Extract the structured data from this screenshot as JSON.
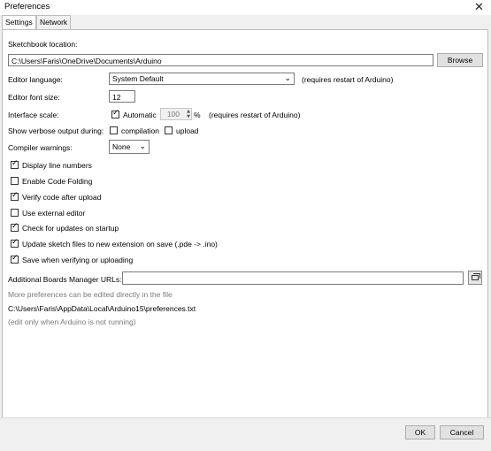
{
  "window": {
    "title": "Preferences",
    "close_glyph": "✕"
  },
  "tabs": [
    {
      "label": "Settings",
      "active": true
    },
    {
      "label": "Network",
      "active": false
    }
  ],
  "sketchbook": {
    "label": "Sketchbook location:",
    "value": "C:\\Users\\Faris\\OneDrive\\Documents\\Arduino",
    "browse_label": "Browse"
  },
  "editor_language": {
    "label": "Editor language:",
    "value": "System Default",
    "note": "(requires restart of Arduino)"
  },
  "editor_font_size": {
    "label": "Editor font size:",
    "value": "12"
  },
  "interface_scale": {
    "label": "Interface scale:",
    "automatic_label": "Automatic",
    "automatic_checked": true,
    "value": "100",
    "unit": "%",
    "note": "(requires restart of Arduino)"
  },
  "verbose": {
    "label": "Show verbose output during:",
    "compilation_label": "compilation",
    "compilation_checked": false,
    "upload_label": "upload",
    "upload_checked": false
  },
  "compiler_warnings": {
    "label": "Compiler warnings:",
    "value": "None"
  },
  "options": [
    {
      "label": "Display line numbers",
      "checked": true
    },
    {
      "label": "Enable Code Folding",
      "checked": false
    },
    {
      "label": "Verify code after upload",
      "checked": true
    },
    {
      "label": "Use external editor",
      "checked": false
    },
    {
      "label": "Check for updates on startup",
      "checked": true
    },
    {
      "label": "Update sketch files to new extension on save (.pde -> .ino)",
      "checked": true
    },
    {
      "label": "Save when verifying or uploading",
      "checked": true
    }
  ],
  "boards_manager": {
    "label": "Additional Boards Manager URLs:",
    "value": ""
  },
  "info": {
    "more_prefs": "More preferences can be edited directly in the file",
    "path": "C:\\Users\\Faris\\AppData\\Local\\Arduino15\\preferences.txt",
    "edit_note": "(edit only when Arduino is not running)"
  },
  "footer": {
    "ok_label": "OK",
    "cancel_label": "Cancel"
  },
  "icons": {
    "close": "close-icon",
    "dropdown": "chevron-down-icon",
    "spinner": "spinner-arrows-icon",
    "expand": "window-expand-icon",
    "check": "checkmark-icon"
  }
}
